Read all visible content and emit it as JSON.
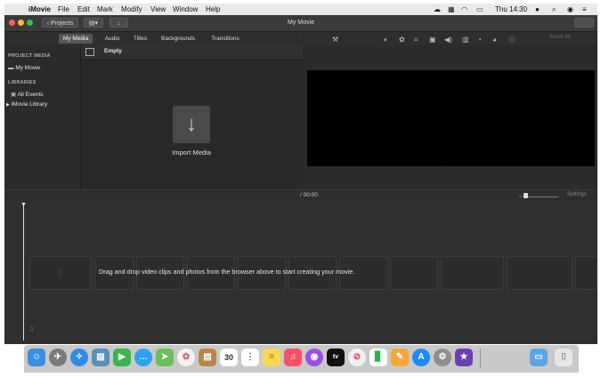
{
  "menubar": {
    "app_name": "iMovie",
    "items": [
      "File",
      "Edit",
      "Mark",
      "Modify",
      "View",
      "Window",
      "Help"
    ],
    "clock": "Thu 14:30"
  },
  "window": {
    "title": "My Movie",
    "projects_button": "Projects"
  },
  "browser": {
    "tabs": [
      "My Media",
      "Audio",
      "Titles",
      "Backgrounds",
      "Transitions"
    ],
    "active_tab": "My Media",
    "event_title": "Empty",
    "import_label": "Import Media"
  },
  "sidebar": {
    "project_media_header": "PROJECT MEDIA",
    "project_item": "My Movie",
    "libraries_header": "LIBRARIES",
    "all_events": "All Events",
    "library_item": "iMovie Library"
  },
  "viewer": {
    "reset_all": "Reset All"
  },
  "timeline": {
    "time_display": "/ 00:00",
    "settings_label": "Settings",
    "empty_message": "Drag and drop video clips and photos from the browser above to start creating your movie."
  },
  "dock": {
    "calendar_day": "30",
    "apps": [
      "finder",
      "launchpad",
      "safari",
      "photo-preview",
      "facetime",
      "messages",
      "maps",
      "photos",
      "contacts",
      "calendar",
      "reminders",
      "notes",
      "music",
      "podcasts",
      "tv",
      "news",
      "numbers",
      "pages",
      "app-store",
      "system-preferences",
      "imovie",
      "folder",
      "trash"
    ]
  },
  "colors": {
    "window_bg": "#2a2a2a",
    "viewer_bg": "#000000",
    "traffic_red": "#ff5f57",
    "traffic_yellow": "#febc2e",
    "traffic_green": "#28c840"
  }
}
